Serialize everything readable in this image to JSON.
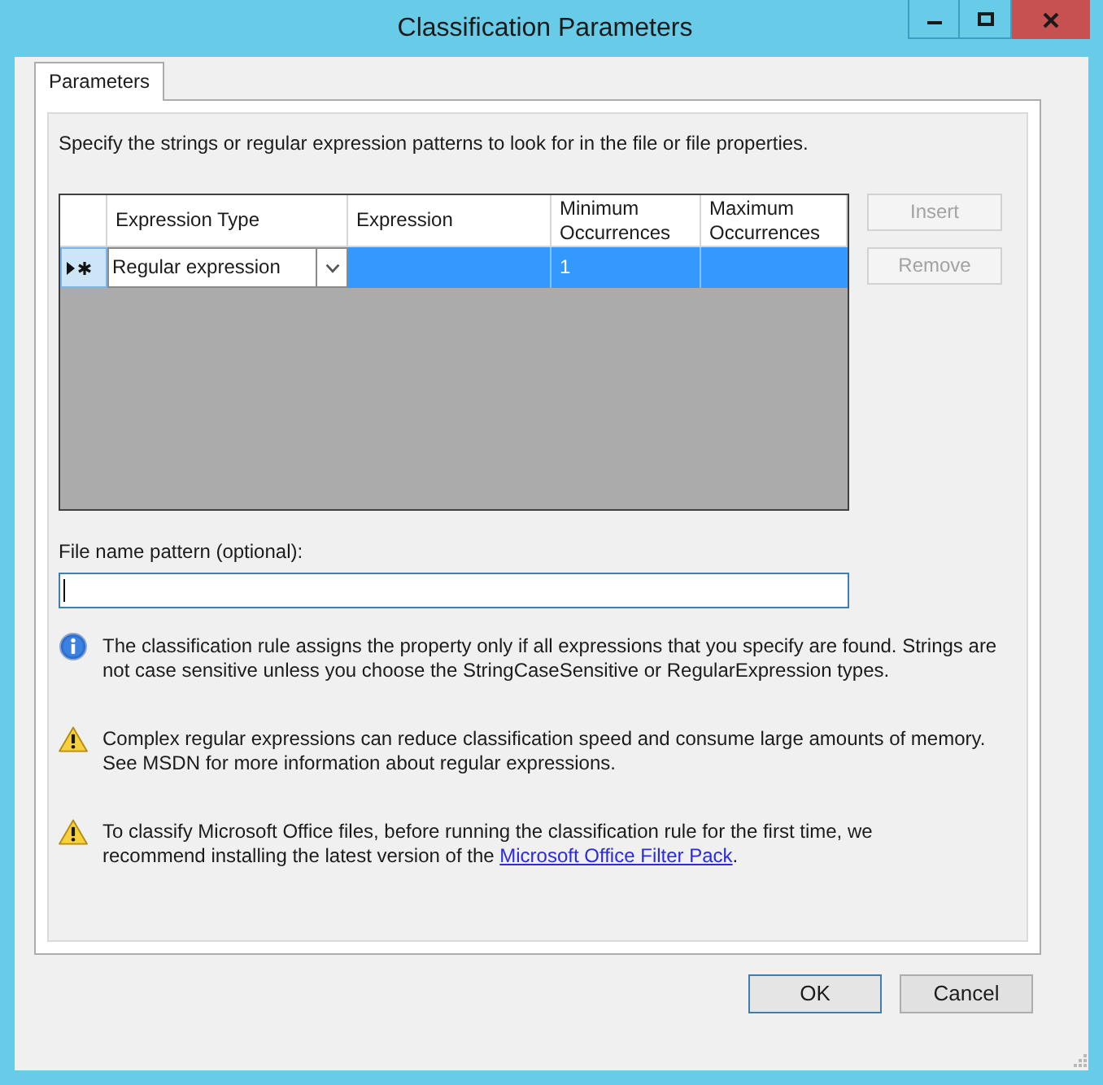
{
  "window": {
    "title": "Classification Parameters"
  },
  "tabs": [
    {
      "label": "Parameters",
      "selected": true
    }
  ],
  "description": "Specify the strings or regular expression patterns to look for in the file or file properties.",
  "grid": {
    "columns": [
      "Expression Type",
      "Expression",
      "Minimum Occurrences",
      "Maximum Occurrences"
    ],
    "rows": [
      {
        "selected": true,
        "current": true,
        "new_row": true,
        "expression_type": "Regular expression",
        "minimum_occurrences": "1"
      }
    ]
  },
  "side_buttons": [
    {
      "label": "Insert",
      "disabled": true
    },
    {
      "label": "Remove",
      "disabled": true
    }
  ],
  "file_name_pattern": {
    "label": "File name pattern (optional):",
    "focused": true
  },
  "notes": [
    {
      "kind": "info",
      "lines": [
        "The classification rule assigns the property only if all expressions that you specify are found. Strings are",
        "not case sensitive unless you choose the StringCaseSensitive or RegularExpression types."
      ]
    },
    {
      "kind": "warning",
      "lines": [
        "Complex regular expressions can reduce classification speed and consume large amounts of memory.",
        "See MSDN for more information about regular expressions."
      ]
    },
    {
      "kind": "warning",
      "lines": [
        "To classify Microsoft Office files, before running the classification rule for the first time, we",
        "recommend installing the latest version of the"
      ],
      "link": "Microsoft Office Filter Pack",
      "text_after": "."
    }
  ],
  "buttons": [
    {
      "label": "OK",
      "default": true
    },
    {
      "label": "Cancel",
      "default": false
    }
  ]
}
